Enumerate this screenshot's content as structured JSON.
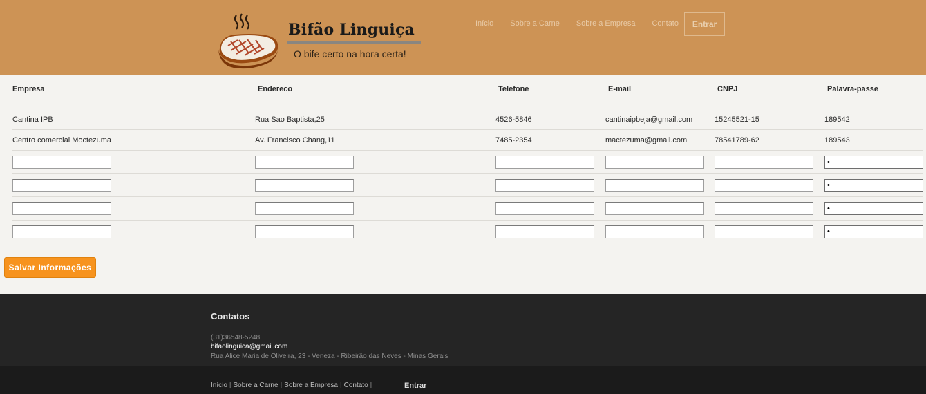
{
  "brand": {
    "title": "Bifão Linguiça",
    "subtitle": "O bife certo na hora certa!"
  },
  "nav": {
    "items": [
      "Início",
      "Sobre a Carne",
      "Sobre a Empresa",
      "Contato"
    ],
    "login_label": "Entrar"
  },
  "table": {
    "headers": [
      "Empresa",
      "Endereco",
      "Telefone",
      "E-mail",
      "CNPJ",
      "Palavra-passe"
    ],
    "rows": [
      [
        "Cantina IPB",
        "Rua Sao Baptista,25",
        "4526-5846",
        "cantinaipbeja@gmail.com",
        "15245521-15",
        "189542"
      ],
      [
        "Centro comercial Moctezuma",
        "Av. Francisco Chang,11",
        "7485-2354",
        "mactezuma@gmail.com",
        "78541789-62",
        "189543"
      ]
    ],
    "new_row_password_value": "•"
  },
  "save_label": "Salvar Informações",
  "footer": {
    "title": "Contatos",
    "phone": "(31)36548-5248",
    "email": "bifaolinguica@gmail.com",
    "address": "Rua Alice Maria de Oliveira, 23 - Veneza - Ribeirão das Neves - Minas Gerais",
    "links": [
      "Início",
      "Sobre a Carne",
      "Sobre a Empresa",
      "Contato"
    ],
    "login_label": "Entrar"
  },
  "colors": {
    "header_bg": "#cd9355",
    "button_orange": "#f7931e",
    "footer_bg": "#252525"
  }
}
